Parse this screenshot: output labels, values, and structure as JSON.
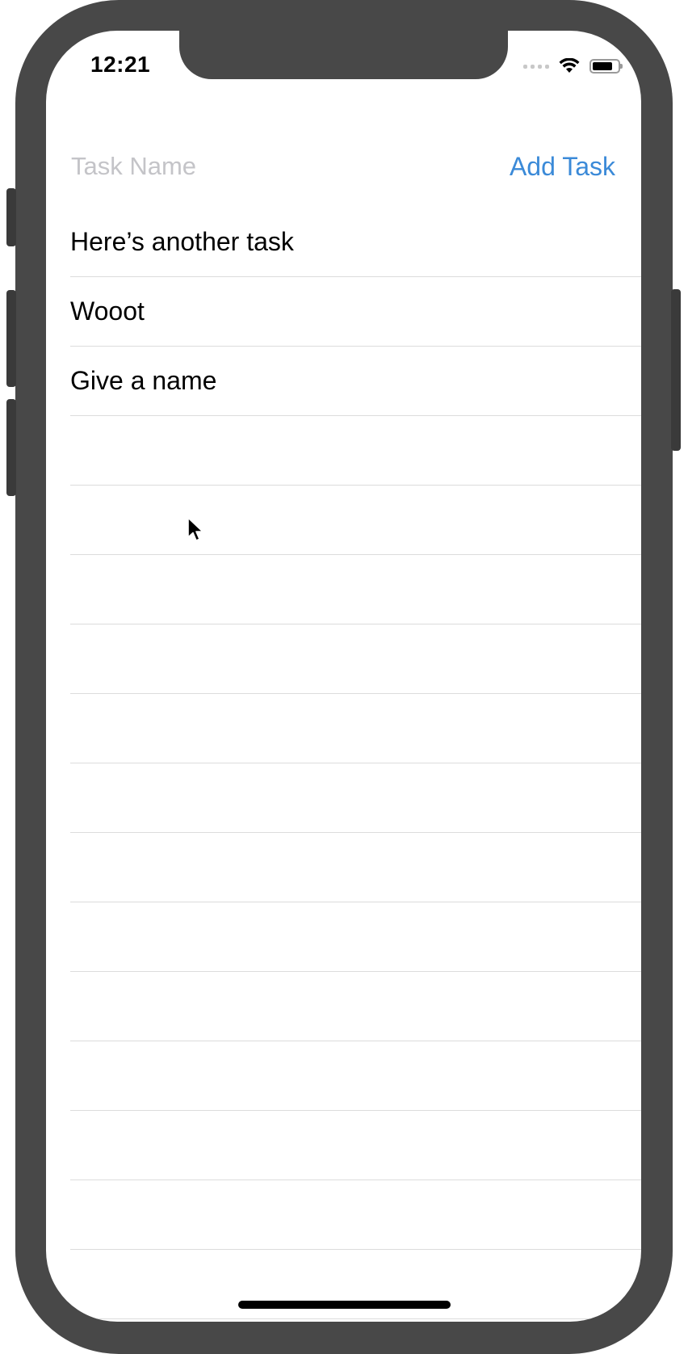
{
  "status_bar": {
    "time": "12:21"
  },
  "input": {
    "value": "",
    "placeholder": "Task Name"
  },
  "add_button": {
    "label": "Add Task"
  },
  "tasks": [
    {
      "label": "Here’s another task"
    },
    {
      "label": "Wooot"
    },
    {
      "label": "Give a name"
    },
    {
      "label": ""
    },
    {
      "label": ""
    },
    {
      "label": ""
    },
    {
      "label": ""
    },
    {
      "label": ""
    },
    {
      "label": ""
    },
    {
      "label": ""
    },
    {
      "label": ""
    },
    {
      "label": ""
    },
    {
      "label": ""
    },
    {
      "label": ""
    },
    {
      "label": ""
    },
    {
      "label": ""
    }
  ],
  "colors": {
    "accent": "#3b8ad8",
    "device_frame": "#484848",
    "placeholder": "#c4c4c8",
    "separator": "#dcdcdc"
  },
  "icons": [
    "cellular-signal-icon",
    "wifi-icon",
    "battery-icon",
    "pointer-cursor-icon"
  ]
}
